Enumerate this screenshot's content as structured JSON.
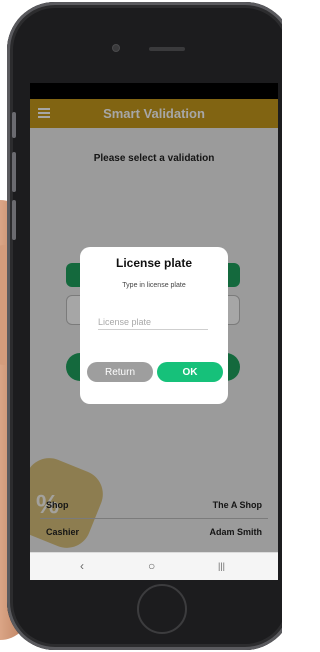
{
  "app_bar": {
    "title": "Smart Validation",
    "menu_icon": "hamburger-menu-icon",
    "color": "#c79a1c"
  },
  "main": {
    "instruction": "Please select a validation"
  },
  "info": {
    "rows": [
      {
        "label": "Shop",
        "value": "The A Shop"
      },
      {
        "label": "Cashier",
        "value": "Adam Smith"
      }
    ]
  },
  "badge": {
    "symbol": "%",
    "icon": "percent-badge-icon"
  },
  "dialog": {
    "title": "License plate",
    "subtitle": "Type in license plate",
    "input_placeholder": "License plate",
    "input_value": "",
    "return_label": "Return",
    "ok_label": "OK",
    "ok_color": "#16c17a",
    "return_color": "#9e9e9e"
  },
  "nav_bar": {
    "back_symbol": "‹",
    "home_symbol": "○",
    "recents_symbol": "|||",
    "back_icon": "back-icon",
    "home_icon": "home-icon",
    "recents_icon": "recents-icon"
  }
}
